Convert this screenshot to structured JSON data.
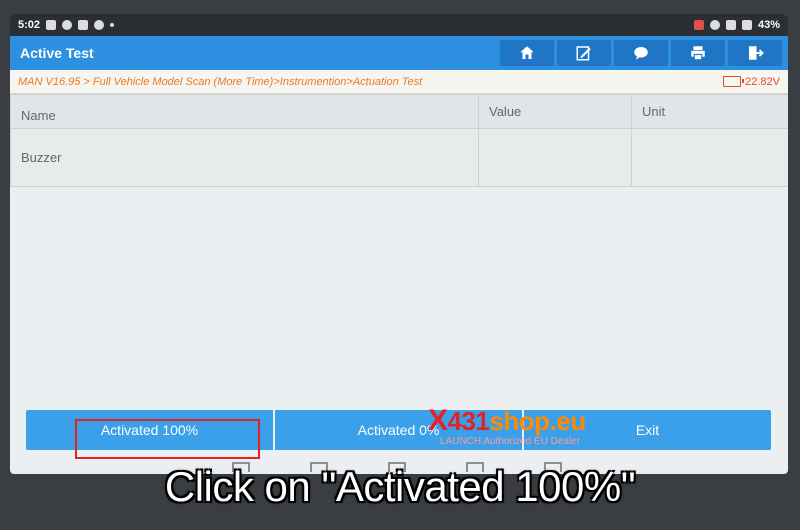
{
  "status_bar": {
    "time": "5:02",
    "battery": "43%"
  },
  "header": {
    "title": "Active Test",
    "toolbar": [
      {
        "name": "home-icon"
      },
      {
        "name": "edit-report-icon"
      },
      {
        "name": "chat-icon"
      },
      {
        "name": "print-icon"
      },
      {
        "name": "exit-icon"
      }
    ]
  },
  "breadcrumb": "MAN V16.95 > Full Vehicle Model Scan (More Time)>Instrumention>Actuation Test",
  "voltage": "22.82V",
  "table": {
    "headers": {
      "name": "Name",
      "value": "Value",
      "unit": "Unit"
    },
    "rows": [
      {
        "name": "Buzzer",
        "value": "",
        "unit": ""
      }
    ]
  },
  "buttons": {
    "activated_100": "Activated 100%",
    "activated_0": "Activated 0%",
    "exit": "Exit"
  },
  "watermark": {
    "x": "X",
    "num": "431",
    "domain": "shop.eu",
    "sub": "LAUNCH Authorized EU Dealer"
  },
  "caption": "Click on \"Activated 100%\"",
  "colors": {
    "header_blue": "#2d8fe0",
    "button_blue": "#3aa0ea",
    "highlight_red": "#e32222",
    "breadcrumb_orange": "#e67a2e"
  }
}
